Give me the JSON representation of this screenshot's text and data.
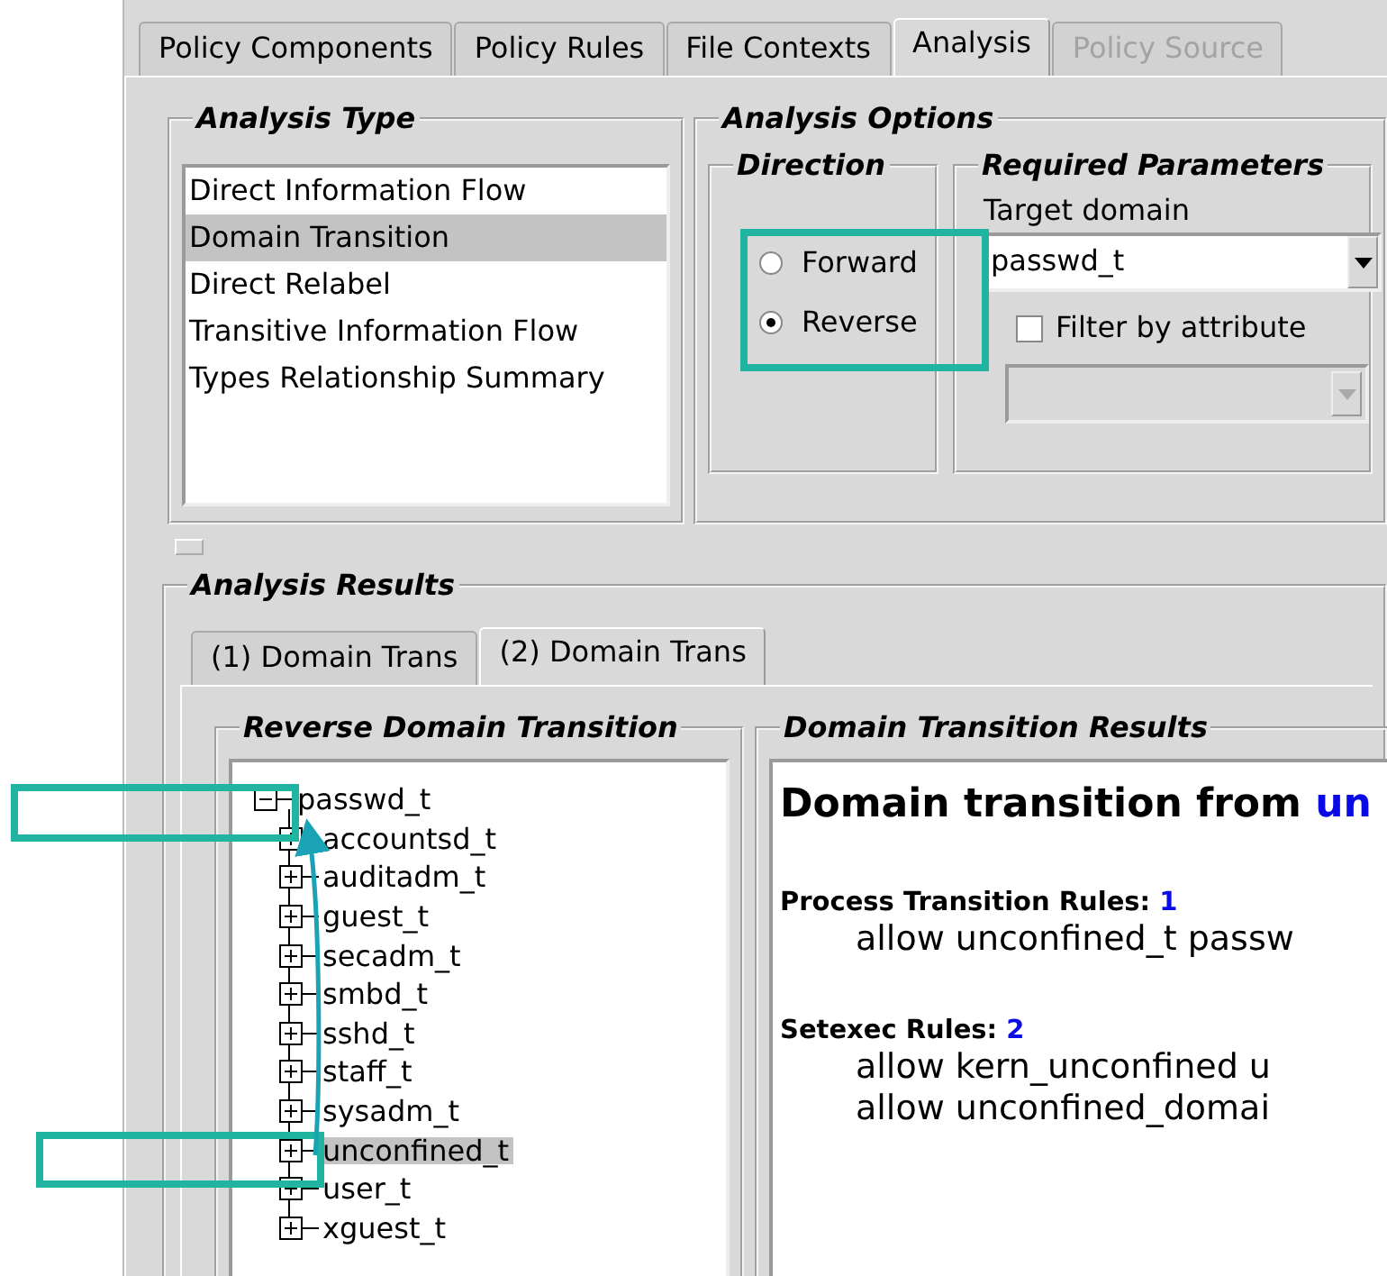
{
  "tabs": [
    {
      "label": "Policy Components",
      "selected": false,
      "disabled": false
    },
    {
      "label": "Policy Rules",
      "selected": false,
      "disabled": false
    },
    {
      "label": "File Contexts",
      "selected": false,
      "disabled": false
    },
    {
      "label": "Analysis",
      "selected": true,
      "disabled": false
    },
    {
      "label": "Policy Source",
      "selected": false,
      "disabled": true
    }
  ],
  "analysis_type": {
    "title": "Analysis Type",
    "items": [
      {
        "label": "Direct Information Flow",
        "selected": false
      },
      {
        "label": "Domain Transition",
        "selected": true
      },
      {
        "label": "Direct Relabel",
        "selected": false
      },
      {
        "label": "Transitive Information Flow",
        "selected": false
      },
      {
        "label": "Types Relationship Summary",
        "selected": false
      }
    ]
  },
  "analysis_options": {
    "title": "Analysis Options",
    "direction": {
      "title": "Direction",
      "options": [
        {
          "label": "Forward",
          "selected": false
        },
        {
          "label": "Reverse",
          "selected": true
        }
      ]
    },
    "required_parameters": {
      "title": "Required Parameters",
      "target_label": "Target domain",
      "target_value": "passwd_t",
      "filter_label": "Filter by attribute",
      "filter_checked": false,
      "attribute_disabled": true
    }
  },
  "analysis_results": {
    "title": "Analysis Results",
    "tabs": [
      {
        "label": "(1) Domain Trans",
        "selected": false
      },
      {
        "label": "(2) Domain Trans",
        "selected": true
      }
    ],
    "tree": {
      "title": "Reverse Domain Transition",
      "root": {
        "label": "passwd_t",
        "expanded": true,
        "children": [
          {
            "label": "accountsd_t",
            "expanded": false,
            "selected": false
          },
          {
            "label": "auditadm_t",
            "expanded": false,
            "selected": false
          },
          {
            "label": "guest_t",
            "expanded": false,
            "selected": false
          },
          {
            "label": "secadm_t",
            "expanded": false,
            "selected": false
          },
          {
            "label": "smbd_t",
            "expanded": false,
            "selected": false
          },
          {
            "label": "sshd_t",
            "expanded": false,
            "selected": false
          },
          {
            "label": "staff_t",
            "expanded": false,
            "selected": false
          },
          {
            "label": "sysadm_t",
            "expanded": false,
            "selected": false
          },
          {
            "label": "unconfined_t",
            "expanded": false,
            "selected": true
          },
          {
            "label": "user_t",
            "expanded": false,
            "selected": false
          },
          {
            "label": "xguest_t",
            "expanded": false,
            "selected": false
          }
        ]
      }
    },
    "results": {
      "title": "Domain Transition Results",
      "heading": "Domain transition from",
      "heading_domain": "un",
      "sections": [
        {
          "label": "Process Transition Rules:",
          "count": "1",
          "rules": [
            "allow unconfined_t passw"
          ]
        },
        {
          "label": "Setexec Rules:",
          "count": "2",
          "rules": [
            "allow kern_unconfined u",
            "allow unconfined_domai"
          ]
        }
      ]
    }
  },
  "annotations": [
    {
      "kind": "box"
    },
    {
      "kind": "box"
    },
    {
      "kind": "box"
    },
    {
      "kind": "arrow"
    }
  ]
}
